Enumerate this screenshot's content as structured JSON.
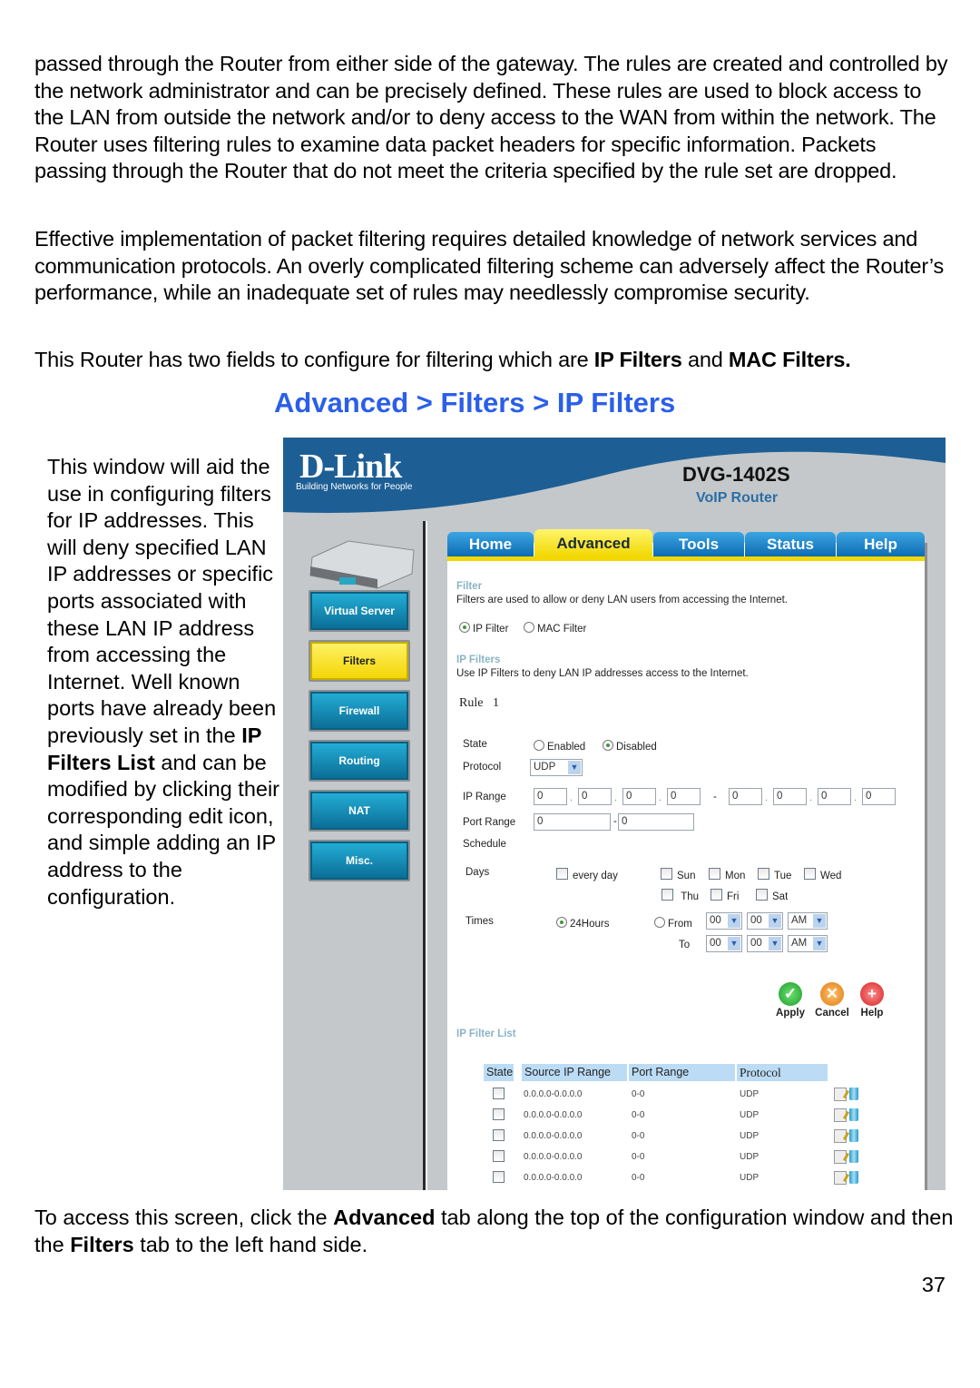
{
  "document": {
    "paragraph1": "passed through the Router from either side of the gateway. The rules are created and controlled by the network administrator and can be precisely defined. These rules are used to block access to the LAN from outside the network and/or to deny access to the WAN from within the network. The Router uses filtering rules to examine data packet headers for specific information. Packets passing through the Router that do not meet the criteria specified by the rule set are dropped.",
    "paragraph2": "Effective implementation of packet filtering requires detailed knowledge of network services and communication protocols. An overly complicated filtering scheme can adversely affect the Router’s performance, while an inadequate set of rules may needlessly compromise security.",
    "paragraph3_pre": "This Router has two fields to configure for filtering which are ",
    "paragraph3_b1": "IP Filters",
    "paragraph3_mid": " and ",
    "paragraph3_b2": "MAC Filters.",
    "heading": "Advanced > Filters > IP Filters",
    "side_pre": "This window will aid the use in configuring filters for IP addresses. This will deny specified LAN IP addresses or specific ports associated with these LAN IP address from accessing the Internet. Well known ports have already been previously set in the ",
    "side_bold": "IP Filters List",
    "side_post": " and can be modified by clicking their corresponding edit icon, and simple adding an IP address to the configuration.",
    "bottom_pre": "To access this screen, click the ",
    "bottom_b1": "Advanced",
    "bottom_mid": " tab along the top of the configuration window and then the ",
    "bottom_b2": "Filters",
    "bottom_post": " tab to the left hand side.",
    "page_number": "37",
    "heading_color": "#2b5fe8"
  },
  "router_ui": {
    "brand": "D-Link",
    "tagline": "Building Networks for People",
    "model": "DVG-1402S",
    "model_sub": "VoIP Router",
    "tabs": [
      {
        "label": "Home",
        "active": false
      },
      {
        "label": "Advanced",
        "active": true
      },
      {
        "label": "Tools",
        "active": false
      },
      {
        "label": "Status",
        "active": false
      },
      {
        "label": "Help",
        "active": false
      }
    ],
    "nav": [
      {
        "label": "Virtual Server",
        "active": false
      },
      {
        "label": "Filters",
        "active": true
      },
      {
        "label": "Firewall",
        "active": false
      },
      {
        "label": "Routing",
        "active": false
      },
      {
        "label": "NAT",
        "active": false
      },
      {
        "label": "Misc.",
        "active": false
      }
    ],
    "filter_title": "Filter",
    "filter_desc": "Filters are used to allow or deny LAN users from accessing the Internet.",
    "filter_types": [
      {
        "label": "IP Filter",
        "selected": true
      },
      {
        "label": "MAC Filter",
        "selected": false
      }
    ],
    "ipf_title": "IP Filters",
    "ipf_desc": "Use IP Filters to deny LAN IP addresses access to the Internet.",
    "rule_label": "Rule",
    "rule_number": "1",
    "labels": {
      "state": "State",
      "protocol": "Protocol",
      "ip_range": "IP Range",
      "port_range": "Port Range",
      "schedule": "Schedule",
      "days": "Days",
      "times": "Times",
      "to": "To"
    },
    "state_options": [
      {
        "label": "Enabled",
        "selected": false
      },
      {
        "label": "Disabled",
        "selected": true
      }
    ],
    "protocol_value": "UDP",
    "ip_start": [
      "0",
      "0",
      "0",
      "0"
    ],
    "ip_end": [
      "0",
      "0",
      "0",
      "0"
    ],
    "ip_dash": "-",
    "port_start": "0",
    "port_end": "0",
    "port_dash": "-",
    "every_day": "every day",
    "days": [
      "Sun",
      "Mon",
      "Tue",
      "Wed",
      "Thu",
      "Fri",
      "Sat"
    ],
    "time_24h": "24Hours",
    "time_from": "From",
    "from_time": {
      "hour": "00",
      "minute": "00",
      "ampm": "AM"
    },
    "to_time": {
      "hour": "00",
      "minute": "00",
      "ampm": "AM"
    },
    "actions": {
      "apply": "Apply",
      "cancel": "Cancel",
      "help": "Help"
    },
    "list_title": "IP Filter List",
    "list_headers": [
      "State",
      "Source IP Range",
      "Port Range",
      "Protocol"
    ],
    "list_rows": [
      {
        "range": "0.0.0.0-0.0.0.0",
        "ports": "0-0",
        "protocol": "UDP"
      },
      {
        "range": "0.0.0.0-0.0.0.0",
        "ports": "0-0",
        "protocol": "UDP"
      },
      {
        "range": "0.0.0.0-0.0.0.0",
        "ports": "0-0",
        "protocol": "UDP"
      },
      {
        "range": "0.0.0.0-0.0.0.0",
        "ports": "0-0",
        "protocol": "UDP"
      },
      {
        "range": "0.0.0.0-0.0.0.0",
        "ports": "0-0",
        "protocol": "UDP"
      }
    ]
  }
}
